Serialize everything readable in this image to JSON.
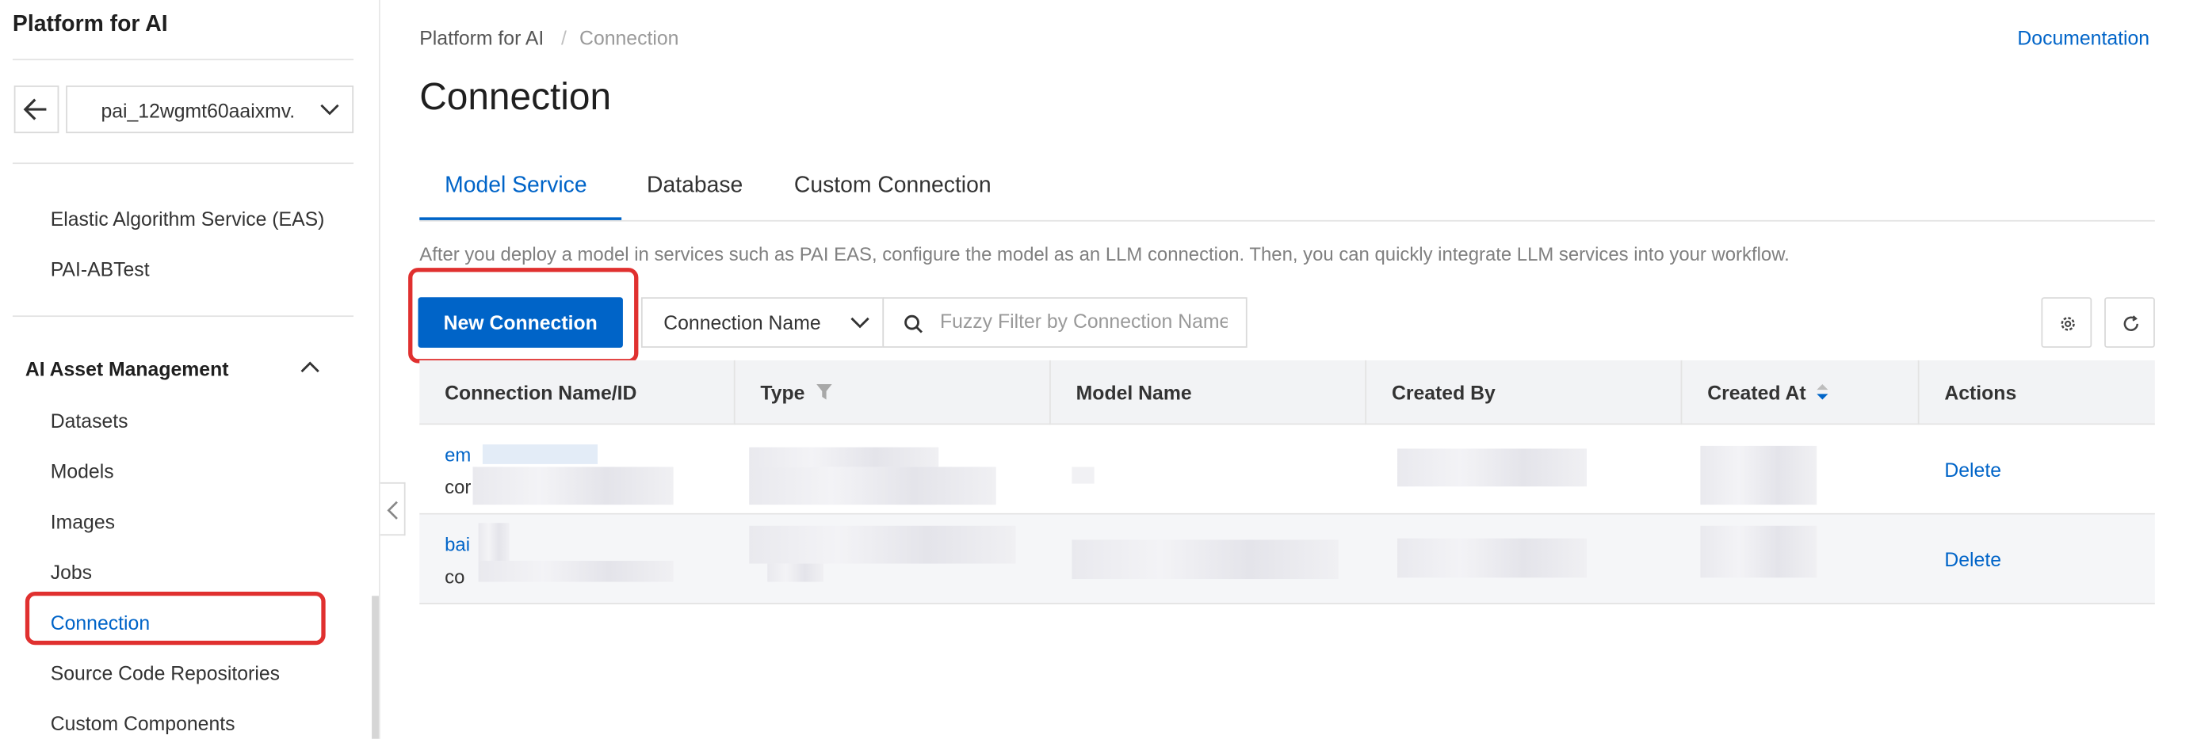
{
  "sidebar": {
    "title": "Platform for AI",
    "workspace": "pai_12wgmt60aaixmv.",
    "items_top": [
      "Elastic Algorithm Service (EAS)",
      "PAI-ABTest"
    ],
    "group_label": "AI Asset Management",
    "group_items": [
      "Datasets",
      "Models",
      "Images",
      "Jobs",
      "Connection",
      "Source Code Repositories",
      "Custom Components"
    ]
  },
  "breadcrumb": {
    "root": "Platform for AI",
    "separator": "/",
    "current": "Connection"
  },
  "doc_link": "Documentation",
  "page_title": "Connection",
  "tabs": [
    "Model Service",
    "Database",
    "Custom Connection"
  ],
  "description": "After you deploy a model in services such as PAI EAS, configure the model as an LLM connection. Then, you can quickly integrate LLM services into your workflow.",
  "toolbar": {
    "new_button": "New Connection",
    "filter_field": "Connection Name",
    "search_placeholder": "Fuzzy Filter by Connection Name"
  },
  "table": {
    "columns": [
      "Connection Name/ID",
      "Type",
      "Model Name",
      "Created By",
      "Created At",
      "Actions"
    ],
    "rows": [
      {
        "name": "em",
        "id": "cor",
        "action": "Delete"
      },
      {
        "name": "bai",
        "id": "co",
        "action": "Delete"
      }
    ]
  },
  "colors": {
    "accent": "#0064c8",
    "highlight": "#e0302f"
  }
}
